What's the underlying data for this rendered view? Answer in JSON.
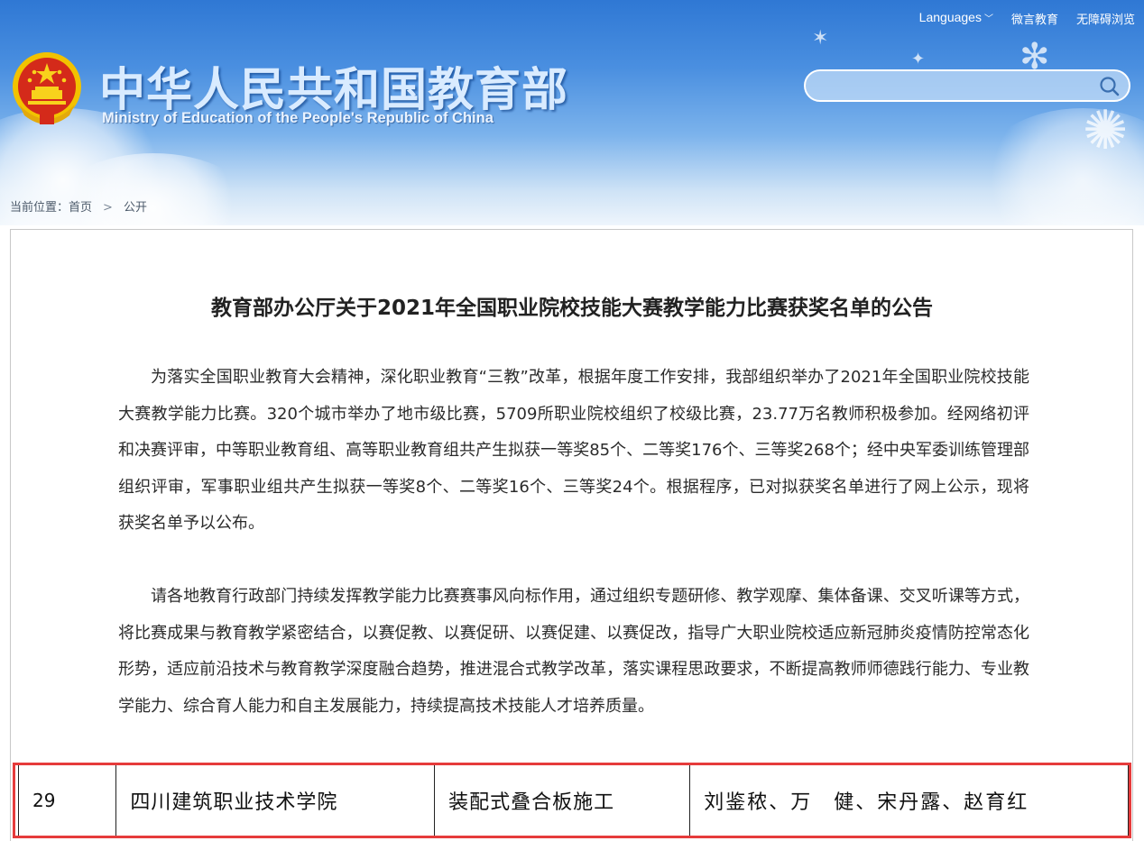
{
  "header": {
    "languages_label": "Languages",
    "weiyan_label": "微言教育",
    "accessibility_label": "无障碍浏览",
    "title_cn": "中华人民共和国教育部",
    "title_en": "Ministry of Education of the People's Republic of China",
    "search_placeholder": "",
    "search_value": ""
  },
  "breadcrumb": {
    "prefix": "当前位置：",
    "home": "首页",
    "separator": ">",
    "current": "公开"
  },
  "article": {
    "title": "教育部办公厅关于2021年全国职业院校技能大赛教学能力比赛获奖名单的公告",
    "paragraph1": "为落实全国职业教育大会精神，深化职业教育“三教”改革，根据年度工作安排，我部组织举办了2021年全国职业院校技能大赛教学能力比赛。320个城市举办了地市级比赛，5709所职业院校组织了校级比赛，23.77万名教师积极参加。经网络初评和决赛评审，中等职业教育组、高等职业教育组共产生拟获一等奖85个、二等奖176个、三等奖268个；经中央军委训练管理部组织评审，军事职业组共产生拟获一等奖8个、二等奖16个、三等奖24个。根据程序，已对拟获奖名单进行了网上公示，现将获奖名单予以公布。",
    "paragraph2": "请各地教育行政部门持续发挥教学能力比赛赛事风向标作用，通过组织专题研修、教学观摩、集体备课、交叉听课等方式，将比赛成果与教育教学紧密结合，以赛促教、以赛促研、以赛促建、以赛促改，指导广大职业院校适应新冠肺炎疫情防控常态化形势，适应前沿技术与教育教学深度融合趋势，推进混合式教学改革，落实课程思政要求，不断提高教师师德践行能力、专业教学能力、综合育人能力和自主发展能力，持续提高技术技能人才培养质量。"
  },
  "highlighted_row": {
    "number": "29",
    "school": "四川建筑职业技术学院",
    "project": "装配式叠合板施工",
    "members": "刘鉴秾、万　健、宋丹露、赵育红"
  },
  "colors": {
    "banner_top": "#2f78d4",
    "highlight_border": "#e63b3b",
    "title_text": "#222222"
  }
}
